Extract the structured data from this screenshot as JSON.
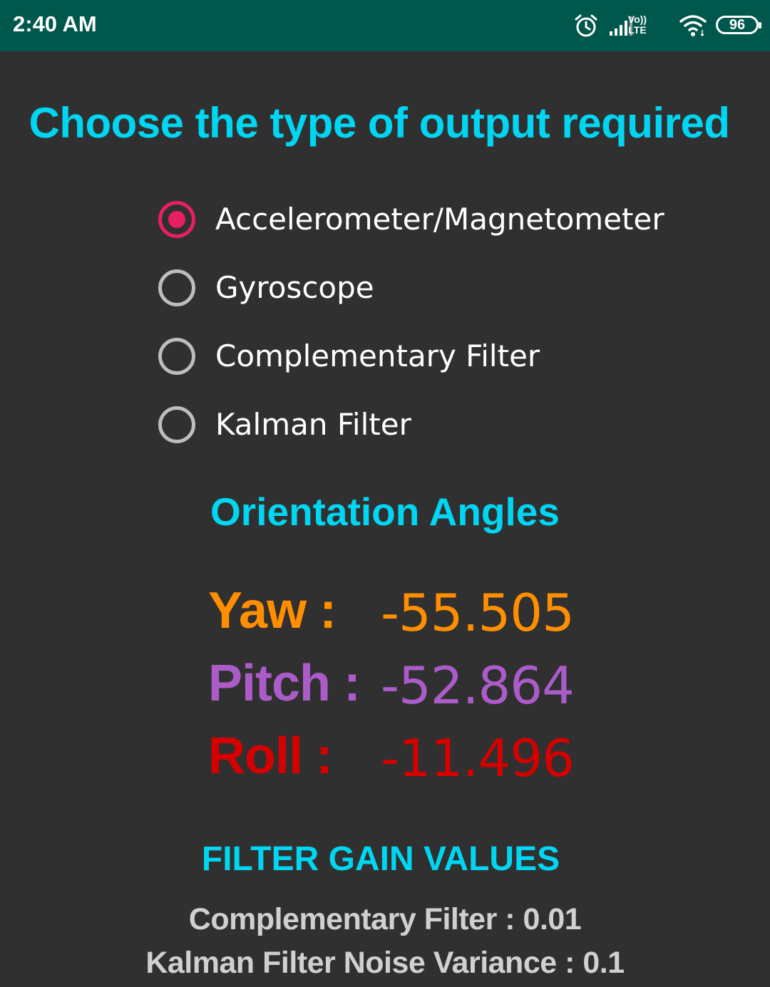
{
  "status_bar": {
    "time": "2:40 AM",
    "volte_top": "Vo))",
    "volte_bottom": "LTE",
    "battery": "96"
  },
  "header": {
    "title": "Choose the type of output required"
  },
  "output_options": [
    {
      "label": "Accelerometer/Magnetometer",
      "selected": true
    },
    {
      "label": "Gyroscope",
      "selected": false
    },
    {
      "label": "Complementary Filter",
      "selected": false
    },
    {
      "label": "Kalman Filter",
      "selected": false
    }
  ],
  "orientation": {
    "title": "Orientation Angles",
    "yaw": {
      "label": "Yaw :",
      "value": "-55.505",
      "color": "#ff8f00"
    },
    "pitch": {
      "label": "Pitch :",
      "value": "-52.864",
      "color": "#ab5cc9"
    },
    "roll": {
      "label": "Roll :",
      "value": "-11.496",
      "color": "#d50000"
    }
  },
  "filter_gains": {
    "title": "FILTER GAIN VALUES",
    "complementary": "Complementary Filter : 0.01",
    "kalman": "Kalman Filter Noise Variance : 0.1"
  },
  "colors": {
    "accent": "#00d5f2",
    "radio_checked": "#e91e63",
    "status_bar": "#00574b",
    "background": "#303030"
  },
  "icons": [
    "alarm-icon",
    "signal-icon",
    "volte-icon",
    "wifi-icon",
    "battery-icon"
  ]
}
